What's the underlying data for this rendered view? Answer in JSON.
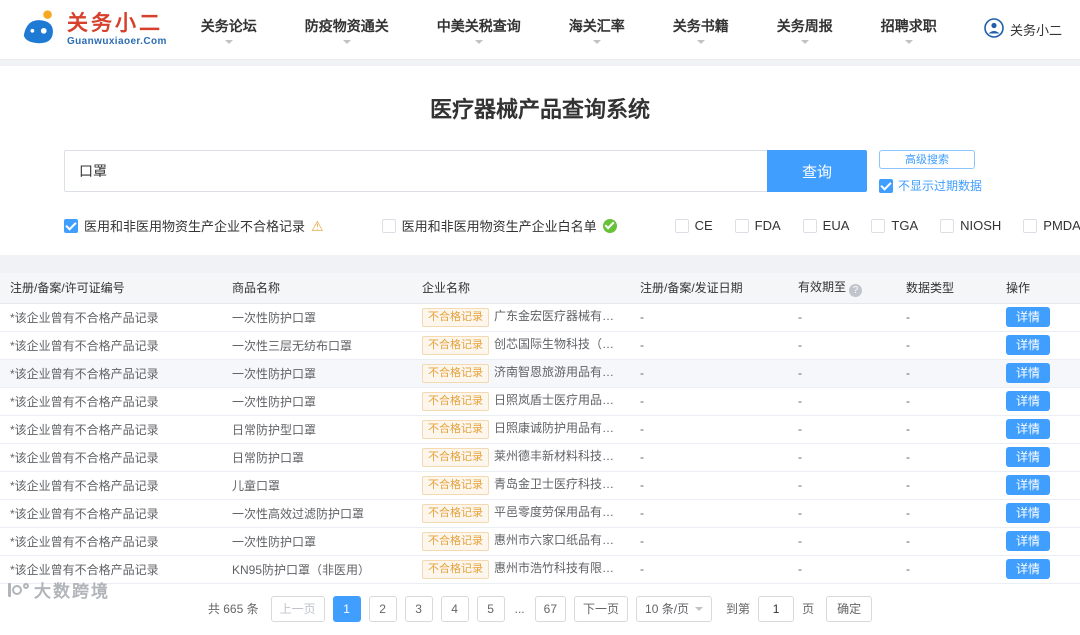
{
  "brand": {
    "name": "关务小二",
    "domain": "Guanwuxiaoer.Com",
    "user_label": "关务小二"
  },
  "nav": {
    "items": [
      "关务论坛",
      "防疫物资通关",
      "中美关税查询",
      "海关汇率",
      "关务书籍",
      "关务周报",
      "招聘求职"
    ]
  },
  "page": {
    "title": "医疗器械产品查询系统"
  },
  "icons": {
    "warning": "⚠",
    "help": "?"
  },
  "search": {
    "value": "口罩",
    "button": "查询",
    "advanced": "高级搜索",
    "hide_expired_label": "不显示过期数据",
    "hide_expired_checked": true
  },
  "filters": [
    {
      "label": "医用和非医用物资生产企业不合格记录",
      "checked": true
    },
    {
      "label": "医用和非医用物资生产企业白名单",
      "checked": false
    },
    {
      "label": "CE",
      "checked": false
    },
    {
      "label": "FDA",
      "checked": false
    },
    {
      "label": "EUA",
      "checked": false
    },
    {
      "label": "TGA",
      "checked": false
    },
    {
      "label": "NIOSH",
      "checked": false
    },
    {
      "label": "PMDA",
      "checked": false
    }
  ],
  "table": {
    "headers": [
      "注册/备案/许可证编号",
      "商品名称",
      "企业名称",
      "注册/备案/发证日期",
      "有效期至",
      "数据类型",
      "操作"
    ],
    "badge": "不合格记录",
    "action": "详情",
    "rows": [
      {
        "reg": "*该企业曾有不合格产品记录",
        "product": "一次性防护口罩",
        "company": "广东金宏医疗器械有限公司",
        "date": "-",
        "valid": "-",
        "type": "-"
      },
      {
        "reg": "*该企业曾有不合格产品记录",
        "product": "一次性三层无纺布口罩",
        "company": "创芯国际生物科技（广州）有限...",
        "date": "-",
        "valid": "-",
        "type": "-"
      },
      {
        "reg": "*该企业曾有不合格产品记录",
        "product": "一次性防护口罩",
        "company": "济南智恩旅游用品有限公司",
        "date": "-",
        "valid": "-",
        "type": "-"
      },
      {
        "reg": "*该企业曾有不合格产品记录",
        "product": "一次性防护口罩",
        "company": "日照岚盾士医疗用品有限责任公司",
        "date": "-",
        "valid": "-",
        "type": "-"
      },
      {
        "reg": "*该企业曾有不合格产品记录",
        "product": "日常防护型口罩",
        "company": "日照康诚防护用品有限公司",
        "date": "-",
        "valid": "-",
        "type": "-"
      },
      {
        "reg": "*该企业曾有不合格产品记录",
        "product": "日常防护口罩",
        "company": "莱州德丰新材料科技有限公司",
        "date": "-",
        "valid": "-",
        "type": "-"
      },
      {
        "reg": "*该企业曾有不合格产品记录",
        "product": "儿童口罩",
        "company": "青岛金卫士医疗科技有限公司",
        "date": "-",
        "valid": "-",
        "type": "-"
      },
      {
        "reg": "*该企业曾有不合格产品记录",
        "product": "一次性高效过滤防护口罩",
        "company": "平邑零度劳保用品有限公司",
        "date": "-",
        "valid": "-",
        "type": "-"
      },
      {
        "reg": "*该企业曾有不合格产品记录",
        "product": "一次性防护口罩",
        "company": "惠州市六家口纸品有限公司",
        "date": "-",
        "valid": "-",
        "type": "-"
      },
      {
        "reg": "*该企业曾有不合格产品记录",
        "product": "KN95防护口罩（非医用）",
        "company": "惠州市浩竹科技有限公司",
        "date": "-",
        "valid": "-",
        "type": "-"
      }
    ]
  },
  "pagination": {
    "total": "共 665 条",
    "prev": "上一页",
    "next": "下一页",
    "pages": [
      "1",
      "2",
      "3",
      "4",
      "5",
      "...",
      "67"
    ],
    "page_size": "10 条/页",
    "goto_label": "到第",
    "goto_value": "1",
    "goto_unit": "页",
    "confirm": "确定"
  },
  "watermark": "大数跨境"
}
